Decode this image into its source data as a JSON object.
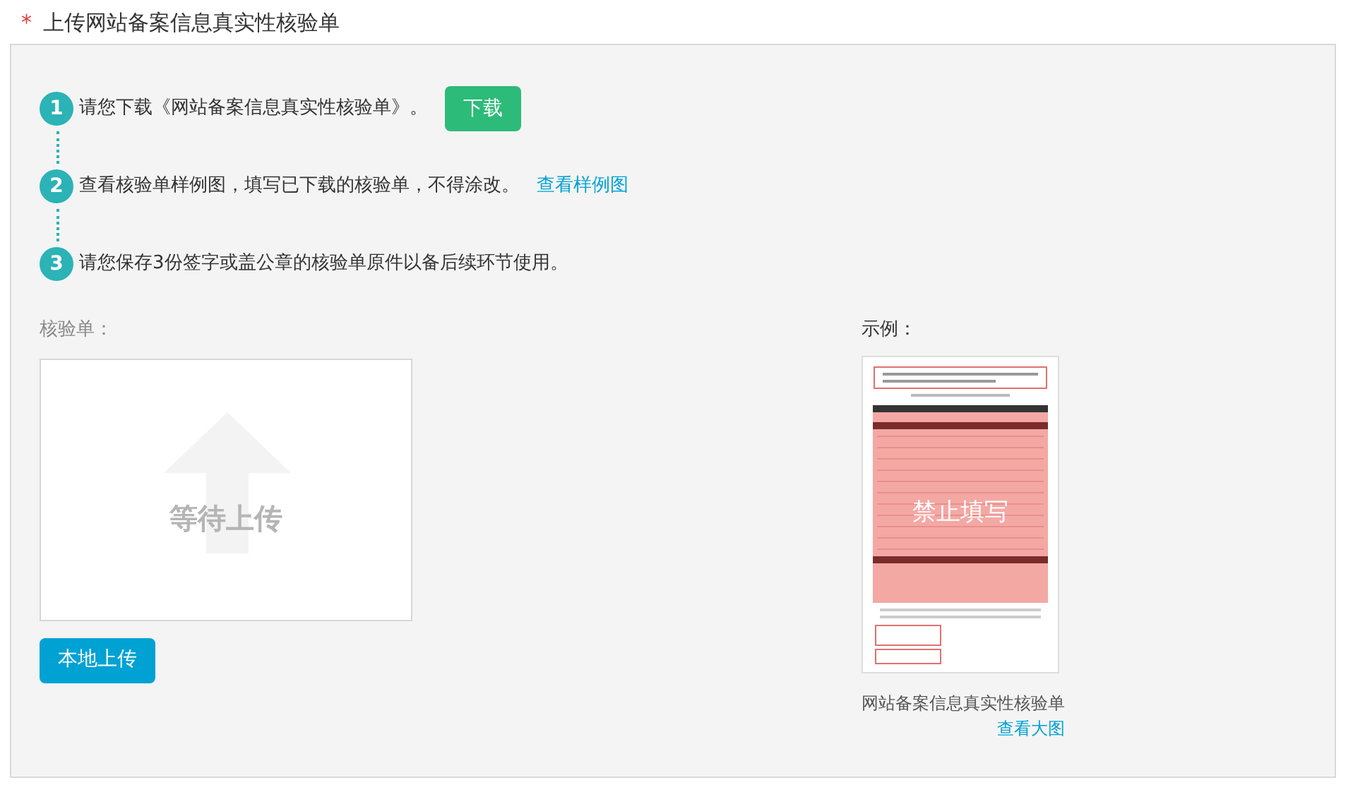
{
  "section": {
    "required_mark": "*",
    "title": "上传网站备案信息真实性核验单"
  },
  "steps": [
    {
      "number": "1",
      "text": "请您下载《网站备案信息真实性核验单》。",
      "kind": "button",
      "action": "下载"
    },
    {
      "number": "2",
      "text": "查看核验单样例图，填写已下载的核验单，不得涂改。",
      "kind": "link",
      "action": "查看样例图"
    },
    {
      "number": "3",
      "text": "请您保存3份签字或盖公章的核验单原件以备后续环节使用。",
      "kind": "plain"
    }
  ],
  "upload": {
    "label": "核验单：",
    "placeholder": "等待上传",
    "button": "本地上传"
  },
  "sample": {
    "label": "示例：",
    "stamp": "禁止填写",
    "caption": "网站备案信息真实性核验单",
    "link": "查看大图"
  }
}
